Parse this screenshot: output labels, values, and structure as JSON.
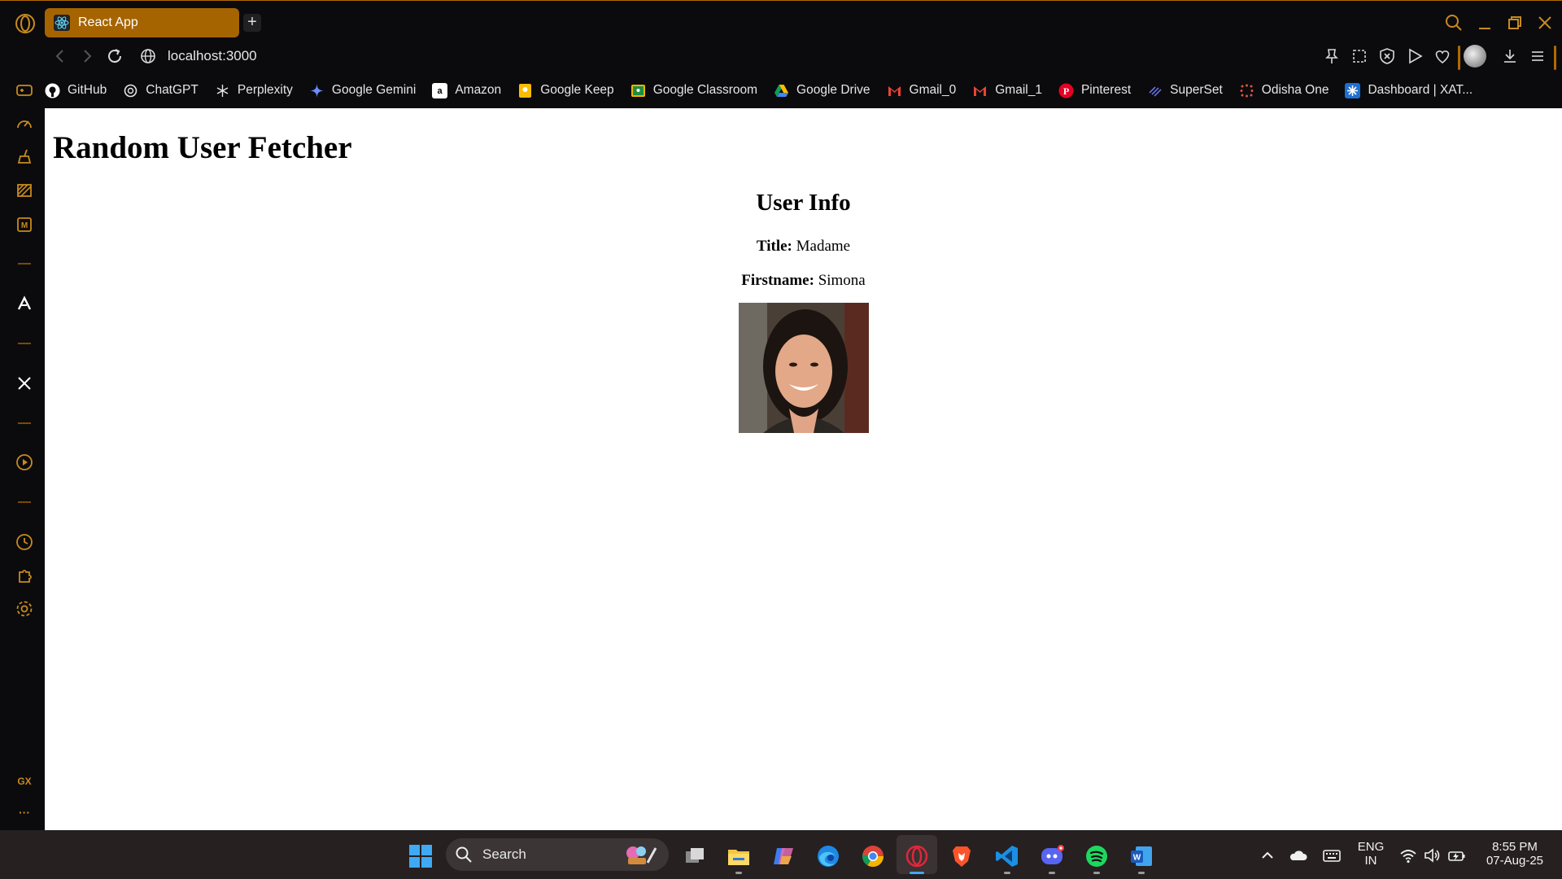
{
  "browser": {
    "tab_title": "React App",
    "new_tab_symbol": "+",
    "url": "localhost:3000",
    "accent_color": "#a66400",
    "bookmarks": [
      {
        "label": "GitHub",
        "icon": "github-icon"
      },
      {
        "label": "ChatGPT",
        "icon": "chatgpt-icon"
      },
      {
        "label": "Perplexity",
        "icon": "perplexity-icon"
      },
      {
        "label": "Google Gemini",
        "icon": "gemini-icon"
      },
      {
        "label": "Amazon",
        "icon": "amazon-icon"
      },
      {
        "label": "Google Keep",
        "icon": "google-keep-icon"
      },
      {
        "label": "Google Classroom",
        "icon": "google-classroom-icon"
      },
      {
        "label": "Google Drive",
        "icon": "google-drive-icon"
      },
      {
        "label": "Gmail_0",
        "icon": "gmail-icon"
      },
      {
        "label": "Gmail_1",
        "icon": "gmail-icon"
      },
      {
        "label": "Pinterest",
        "icon": "pinterest-icon"
      },
      {
        "label": "SuperSet",
        "icon": "superset-icon"
      },
      {
        "label": "Odisha One",
        "icon": "odisha-one-icon"
      },
      {
        "label": "Dashboard | XAT...",
        "icon": "dashboard-icon"
      }
    ],
    "sidebar_gx_label": "GX",
    "sidebar_more_label": "···"
  },
  "page": {
    "heading": "Random User Fetcher",
    "card_title": "User Info",
    "title_label": "Title:",
    "title_value": "Madame",
    "firstname_label": "Firstname:",
    "firstname_value": "Simona"
  },
  "taskbar": {
    "search_label": "Search",
    "lang_line1": "ENG",
    "lang_line2": "IN",
    "time": "8:55 PM",
    "date": "07-Aug-25"
  }
}
